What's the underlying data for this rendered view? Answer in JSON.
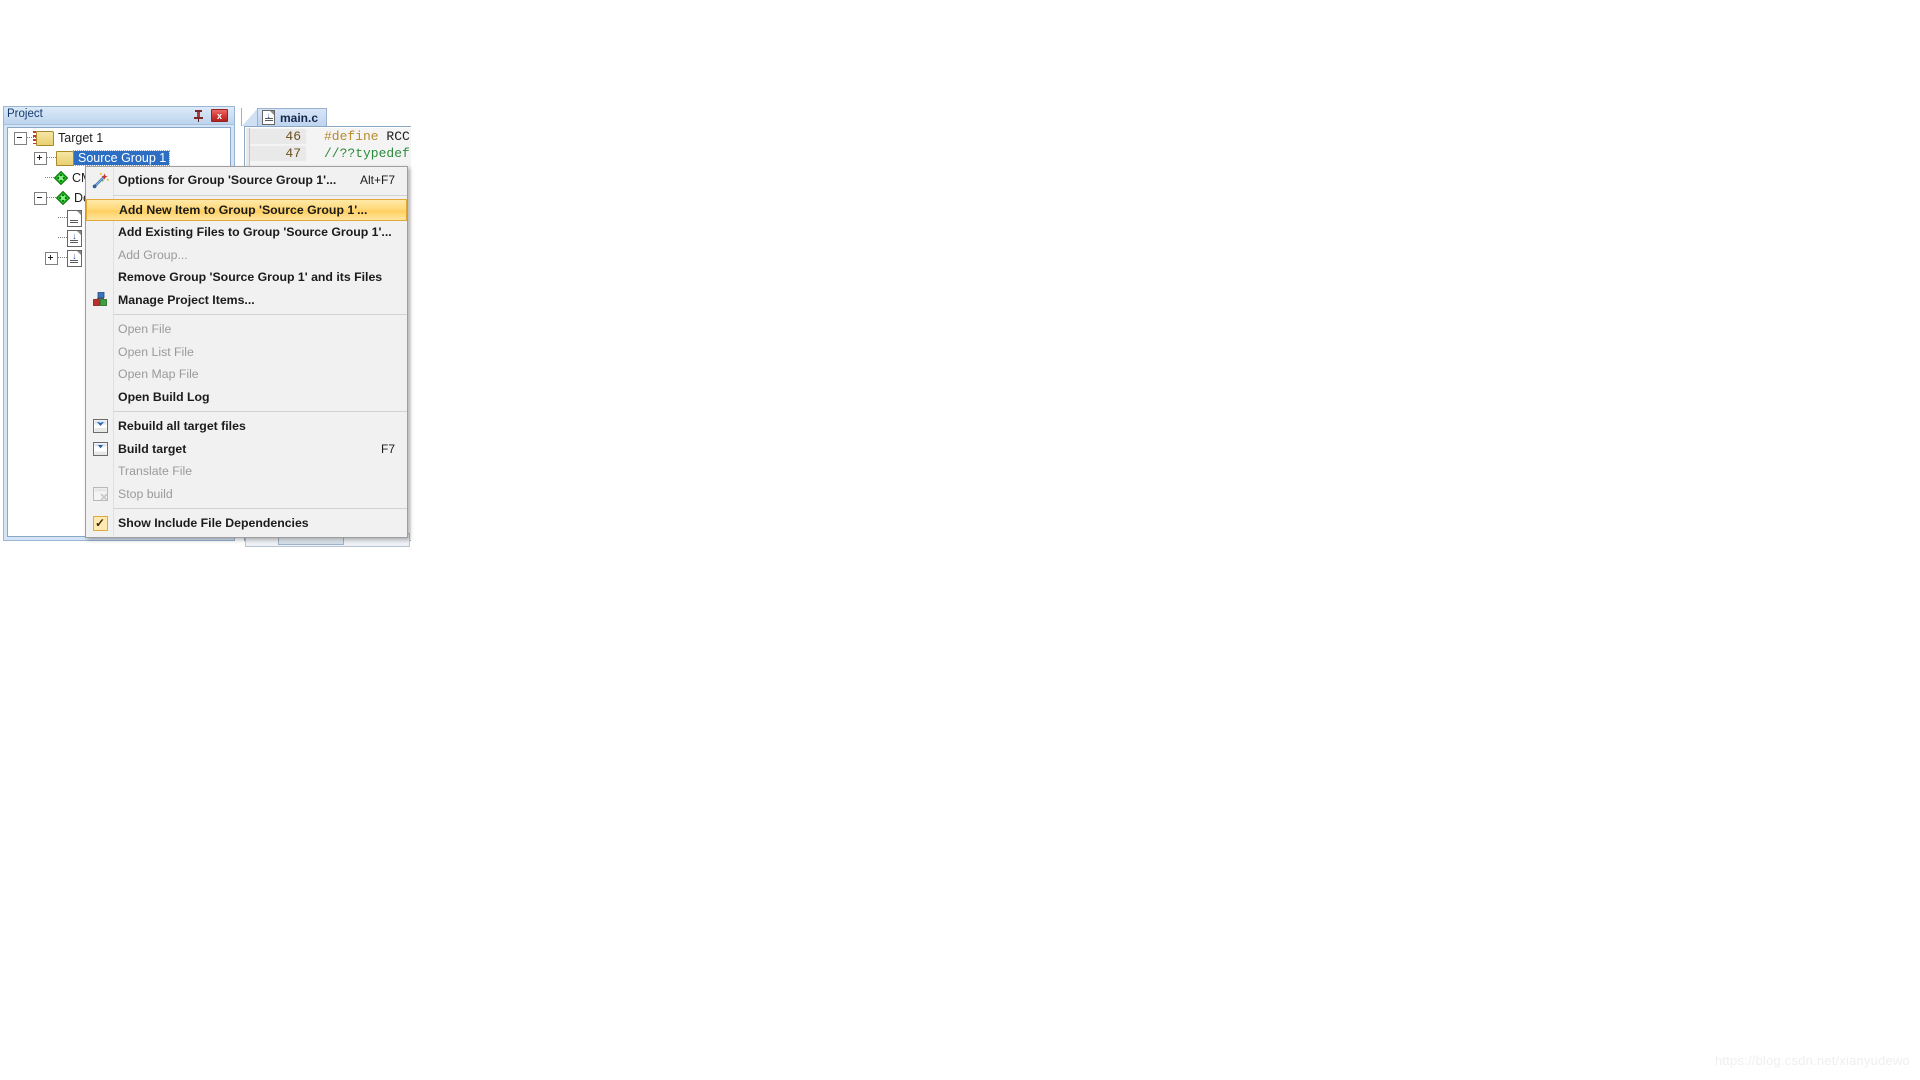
{
  "panel": {
    "title": "Project",
    "pin_icon": "pin-icon",
    "close_label": "x"
  },
  "tree": {
    "nodes": [
      {
        "label": "Target 1",
        "icon": "target-folder-icon",
        "expander": "minus",
        "depth": 0,
        "selected": false
      },
      {
        "label": "Source Group 1",
        "icon": "folder-icon",
        "expander": "plus",
        "depth": 1,
        "selected": true
      },
      {
        "label": "CM",
        "icon": "group-diamond-icon",
        "expander": "none",
        "depth": 1,
        "selected": false
      },
      {
        "label": "Dev",
        "icon": "group-diamond-icon",
        "expander": "minus",
        "depth": 1,
        "selected": false
      },
      {
        "label": "",
        "icon": "source-file-icon",
        "expander": "none",
        "depth": 2,
        "selected": false
      },
      {
        "label": "",
        "icon": "include-file-icon",
        "expander": "none",
        "depth": 2,
        "selected": false
      },
      {
        "label": "",
        "icon": "include-file-icon",
        "expander": "plus",
        "depth": 2,
        "selected": false
      }
    ]
  },
  "editor": {
    "tab_label": "main.c",
    "tab_icon": "source-file-icon",
    "lines": [
      {
        "number": "46",
        "pp": "#define",
        "id": " RCC",
        "comment": ""
      },
      {
        "number": "47",
        "pp": "",
        "id": "",
        "comment": "//??typedef"
      }
    ]
  },
  "context_menu": {
    "items": [
      {
        "label": "Options for Group 'Source Group 1'...",
        "accel": "Alt+F7",
        "icon": "magic-wand-icon",
        "state": "normal",
        "name": "menu-item-options-for-group"
      },
      {
        "separator": true
      },
      {
        "label": "Add New  Item to Group 'Source Group 1'...",
        "accel": "",
        "icon": "",
        "state": "highlighted",
        "name": "menu-item-add-new-item"
      },
      {
        "label": "Add Existing Files to Group 'Source Group 1'...",
        "accel": "",
        "icon": "",
        "state": "normal",
        "name": "menu-item-add-existing-files"
      },
      {
        "label": "Add Group...",
        "accel": "",
        "icon": "",
        "state": "disabled",
        "name": "menu-item-add-group"
      },
      {
        "label": "Remove Group 'Source Group 1' and its Files",
        "accel": "",
        "icon": "",
        "state": "normal",
        "name": "menu-item-remove-group"
      },
      {
        "label": "Manage Project Items...",
        "accel": "",
        "icon": "manage-items-icon",
        "state": "normal",
        "name": "menu-item-manage-project-items"
      },
      {
        "separator": true
      },
      {
        "label": "Open File",
        "accel": "",
        "icon": "",
        "state": "disabled",
        "name": "menu-item-open-file"
      },
      {
        "label": "Open List File",
        "accel": "",
        "icon": "",
        "state": "disabled",
        "name": "menu-item-open-list-file"
      },
      {
        "label": "Open Map File",
        "accel": "",
        "icon": "",
        "state": "disabled",
        "name": "menu-item-open-map-file"
      },
      {
        "label": "Open Build Log",
        "accel": "",
        "icon": "",
        "state": "normal",
        "name": "menu-item-open-build-log"
      },
      {
        "separator": true
      },
      {
        "label": "Rebuild all target files",
        "accel": "",
        "icon": "rebuild-icon",
        "state": "normal",
        "name": "menu-item-rebuild-all"
      },
      {
        "label": "Build target",
        "accel": "F7",
        "icon": "build-icon",
        "state": "normal",
        "name": "menu-item-build-target"
      },
      {
        "label": "Translate File",
        "accel": "",
        "icon": "",
        "state": "disabled",
        "name": "menu-item-translate-file"
      },
      {
        "label": "Stop build",
        "accel": "",
        "icon": "stop-build-icon",
        "state": "disabled",
        "name": "menu-item-stop-build"
      },
      {
        "separator": true
      },
      {
        "label": "Show Include File Dependencies",
        "accel": "",
        "icon": "checkbox-checked-icon",
        "state": "checked",
        "name": "menu-item-show-include-dependencies"
      }
    ]
  },
  "watermark": {
    "text": "https://blog.csdn.net/xianyudewo"
  },
  "colors": {
    "highlight": "#ffd878",
    "selection": "#2b6ec4",
    "title_text": "#16386b",
    "close_red": "#d23c39"
  }
}
